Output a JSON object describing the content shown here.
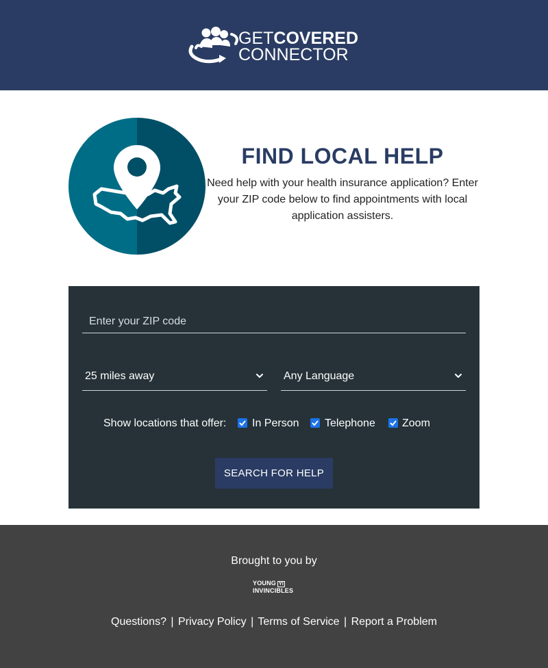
{
  "header": {
    "logo_line1_light": "GET",
    "logo_line1_bold": "COVERED",
    "logo_line2": "CONNECTOR"
  },
  "hero": {
    "title": "FIND LOCAL HELP",
    "description": "Need help with your health insurance application? Enter your ZIP code below to find appointments with local application assisters."
  },
  "search": {
    "zip_placeholder": "Enter your ZIP code",
    "distance_value": "25 miles away",
    "language_value": "Any Language",
    "offer_label": "Show locations that offer:",
    "options": [
      {
        "label": "In Person",
        "checked": true
      },
      {
        "label": "Telephone",
        "checked": true
      },
      {
        "label": "Zoom",
        "checked": true
      }
    ],
    "button_label": "SEARCH FOR HELP"
  },
  "footer": {
    "brought_by": "Brought to you by",
    "sponsor_line1": "YOUNG",
    "sponsor_badge": "YI",
    "sponsor_line2": "INVINCIBLES",
    "links": [
      "Questions?",
      "Privacy Policy",
      "Terms of Service",
      "Report a Problem"
    ],
    "separator": "|"
  },
  "colors": {
    "header_bg": "#2a3c63",
    "panel_bg": "#263238",
    "footer_bg": "#424242",
    "accent_teal": "#006d86",
    "checkbox_blue": "#1a73e8"
  }
}
